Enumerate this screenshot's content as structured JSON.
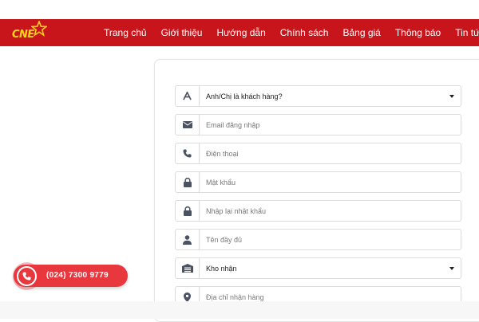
{
  "header": {
    "logo_text": "CNE",
    "nav": [
      "Trang chủ",
      "Giới thiệu",
      "Hướng dẫn",
      "Chính sách",
      "Bảng giá",
      "Thông báo",
      "Tin tức"
    ],
    "background_color": "#c8141b"
  },
  "form": {
    "customer_type": {
      "value": "Anh/Chị là khách hàng?",
      "icon": "letter-a-icon"
    },
    "email": {
      "placeholder": "Email đăng nhập",
      "icon": "envelope-icon"
    },
    "phone": {
      "placeholder": "Điện thoại",
      "icon": "phone-icon"
    },
    "password": {
      "placeholder": "Mật khẩu",
      "icon": "lock-icon"
    },
    "password_confirm": {
      "placeholder": "Nhập lại nhật khẩu",
      "icon": "lock-icon"
    },
    "full_name": {
      "placeholder": "Tên đầy đủ",
      "icon": "user-icon"
    },
    "warehouse": {
      "value": "Kho nhận",
      "icon": "warehouse-icon"
    },
    "address": {
      "placeholder": "Địa chỉ nhận hàng",
      "icon": "map-pin-icon"
    }
  },
  "hotline": {
    "number": "(024) 7300 9779",
    "icon": "phone-icon",
    "color": "#e8373d"
  }
}
